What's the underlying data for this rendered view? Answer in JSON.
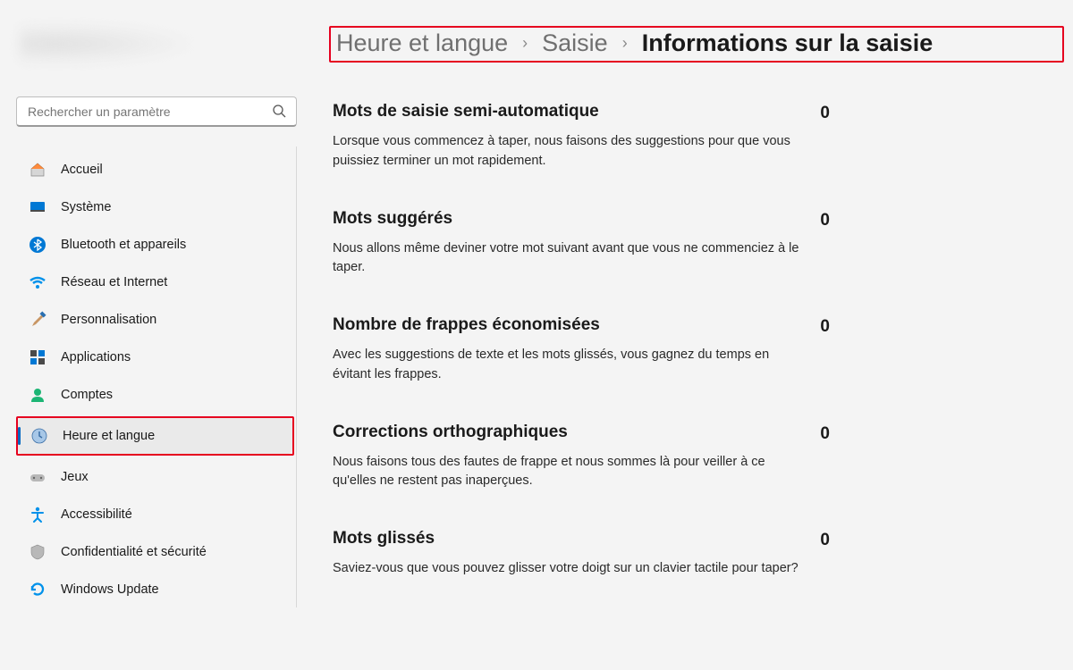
{
  "search": {
    "placeholder": "Rechercher un paramètre"
  },
  "sidebar": {
    "items": [
      {
        "label": "Accueil"
      },
      {
        "label": "Système"
      },
      {
        "label": "Bluetooth et appareils"
      },
      {
        "label": "Réseau et Internet"
      },
      {
        "label": "Personnalisation"
      },
      {
        "label": "Applications"
      },
      {
        "label": "Comptes"
      },
      {
        "label": "Heure et langue"
      },
      {
        "label": "Jeux"
      },
      {
        "label": "Accessibilité"
      },
      {
        "label": "Confidentialité et sécurité"
      },
      {
        "label": "Windows Update"
      }
    ]
  },
  "breadcrumb": {
    "level1": "Heure et langue",
    "level2": "Saisie",
    "current": "Informations sur la saisie"
  },
  "stats": [
    {
      "title": "Mots de saisie semi-automatique",
      "desc": "Lorsque vous commencez à taper, nous faisons des suggestions pour que vous puissiez terminer un mot rapidement.",
      "value": "0"
    },
    {
      "title": "Mots suggérés",
      "desc": "Nous allons même deviner votre mot suivant avant que vous ne commenciez à le taper.",
      "value": "0"
    },
    {
      "title": "Nombre de frappes économisées",
      "desc": "Avec les suggestions de texte et les mots glissés, vous gagnez du temps en évitant les frappes.",
      "value": "0"
    },
    {
      "title": "Corrections orthographiques",
      "desc": "Nous faisons tous des fautes de frappe et nous sommes là pour veiller à ce qu'elles ne restent pas inaperçues.",
      "value": "0"
    },
    {
      "title": "Mots glissés",
      "desc": "Saviez-vous que vous pouvez glisser votre doigt sur un clavier tactile pour taper?",
      "value": "0"
    }
  ]
}
